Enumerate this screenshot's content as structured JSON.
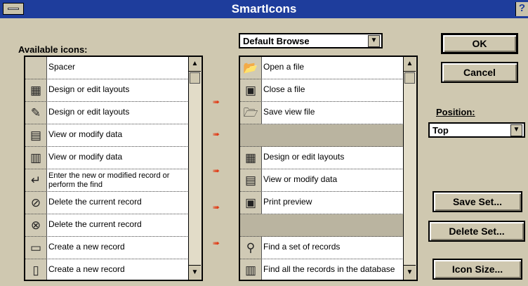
{
  "window": {
    "title": "SmartIcons",
    "help": "?"
  },
  "available": {
    "label": "Available icons:",
    "items": [
      {
        "icon": "spacer-icon",
        "glyph": "",
        "text": "Spacer"
      },
      {
        "icon": "design-layout-icon",
        "glyph": "▦",
        "text": "Design or edit layouts"
      },
      {
        "icon": "pencil-icon",
        "glyph": "✎",
        "text": "Design or edit layouts"
      },
      {
        "icon": "data-view-icon",
        "glyph": "▤",
        "text": "View or modify data"
      },
      {
        "icon": "data-view-icon",
        "glyph": "▥",
        "text": "View or modify data"
      },
      {
        "icon": "enter-icon",
        "glyph": "↵",
        "text": "Enter the new or modified record or perform the find"
      },
      {
        "icon": "delete-record-icon",
        "glyph": "⊘",
        "text": "Delete the current record"
      },
      {
        "icon": "delete-record-icon",
        "glyph": "⊗",
        "text": "Delete the current record"
      },
      {
        "icon": "new-record-icon",
        "glyph": "▭",
        "text": "Create a new record"
      },
      {
        "icon": "new-record-icon",
        "glyph": "▯",
        "text": "Create a new record"
      }
    ]
  },
  "set": {
    "selected": "Default Browse",
    "items": [
      {
        "icon": "open-file-icon",
        "glyph": "📂",
        "text": "Open a file"
      },
      {
        "icon": "close-file-icon",
        "glyph": "▣",
        "text": "Close a file"
      },
      {
        "icon": "save-view-icon",
        "glyph": "🗁",
        "text": "Save view file"
      },
      {
        "icon": "spacer-icon",
        "glyph": "",
        "text": "",
        "gap": true
      },
      {
        "icon": "design-layout-icon",
        "glyph": "▦",
        "text": "Design or edit layouts"
      },
      {
        "icon": "data-view-icon",
        "glyph": "▤",
        "text": "View or modify data"
      },
      {
        "icon": "print-preview-icon",
        "glyph": "▣",
        "text": "Print preview"
      },
      {
        "icon": "spacer-icon",
        "glyph": "",
        "text": "",
        "gap": true
      },
      {
        "icon": "find-icon",
        "glyph": "⚲",
        "text": "Find a set of records"
      },
      {
        "icon": "find-all-icon",
        "glyph": "▥",
        "text": "Find all the records in the database"
      }
    ]
  },
  "buttons": {
    "ok": "OK",
    "cancel": "Cancel",
    "save_set": "Save Set...",
    "delete_set": "Delete Set...",
    "icon_size": "Icon Size..."
  },
  "position": {
    "label": "Position:",
    "value": "Top"
  }
}
